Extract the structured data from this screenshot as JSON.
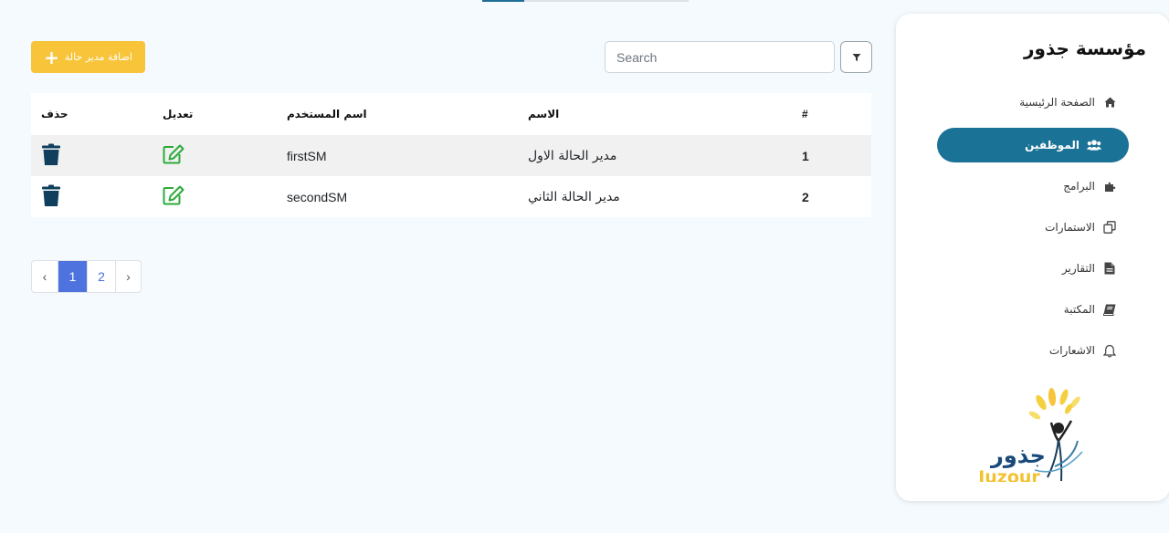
{
  "sidebar": {
    "org_title": "مؤسسة جذور",
    "items": [
      {
        "label": "الصفحة الرئيسية",
        "icon": "home-icon"
      },
      {
        "label": "الموظفين",
        "icon": "users-icon",
        "active": true
      },
      {
        "label": "البرامج",
        "icon": "puzzle-icon"
      },
      {
        "label": "الاستمارات",
        "icon": "copy-icon"
      },
      {
        "label": "التقارير",
        "icon": "file-icon"
      },
      {
        "label": "المكتبة",
        "icon": "book-icon"
      },
      {
        "label": "الاشعارات",
        "icon": "bell-icon"
      }
    ],
    "logo": {
      "arabic": "جذور",
      "latin": "Juzour"
    }
  },
  "toolbar": {
    "add_label": "اضافة مدير حالة",
    "search_placeholder": "Search"
  },
  "table": {
    "headers": {
      "index": "#",
      "name": "الاسم",
      "username": "اسم المستخدم",
      "edit": "تعديل",
      "delete": "حذف"
    },
    "rows": [
      {
        "index": "1",
        "name": "مدير الحالة الاول",
        "username": "firstSM"
      },
      {
        "index": "2",
        "name": "مدير الحالة الثاني",
        "username": "secondSM"
      }
    ]
  },
  "pagination": {
    "prev": "‹",
    "pages": [
      "1",
      "2"
    ],
    "current": "1",
    "next": "›"
  },
  "colors": {
    "accent": "#1a7296",
    "add_button": "#f7c43a",
    "edit_icon": "#2eaa3c",
    "delete_icon": "#0f3f5c",
    "page_active": "#4e73df"
  }
}
